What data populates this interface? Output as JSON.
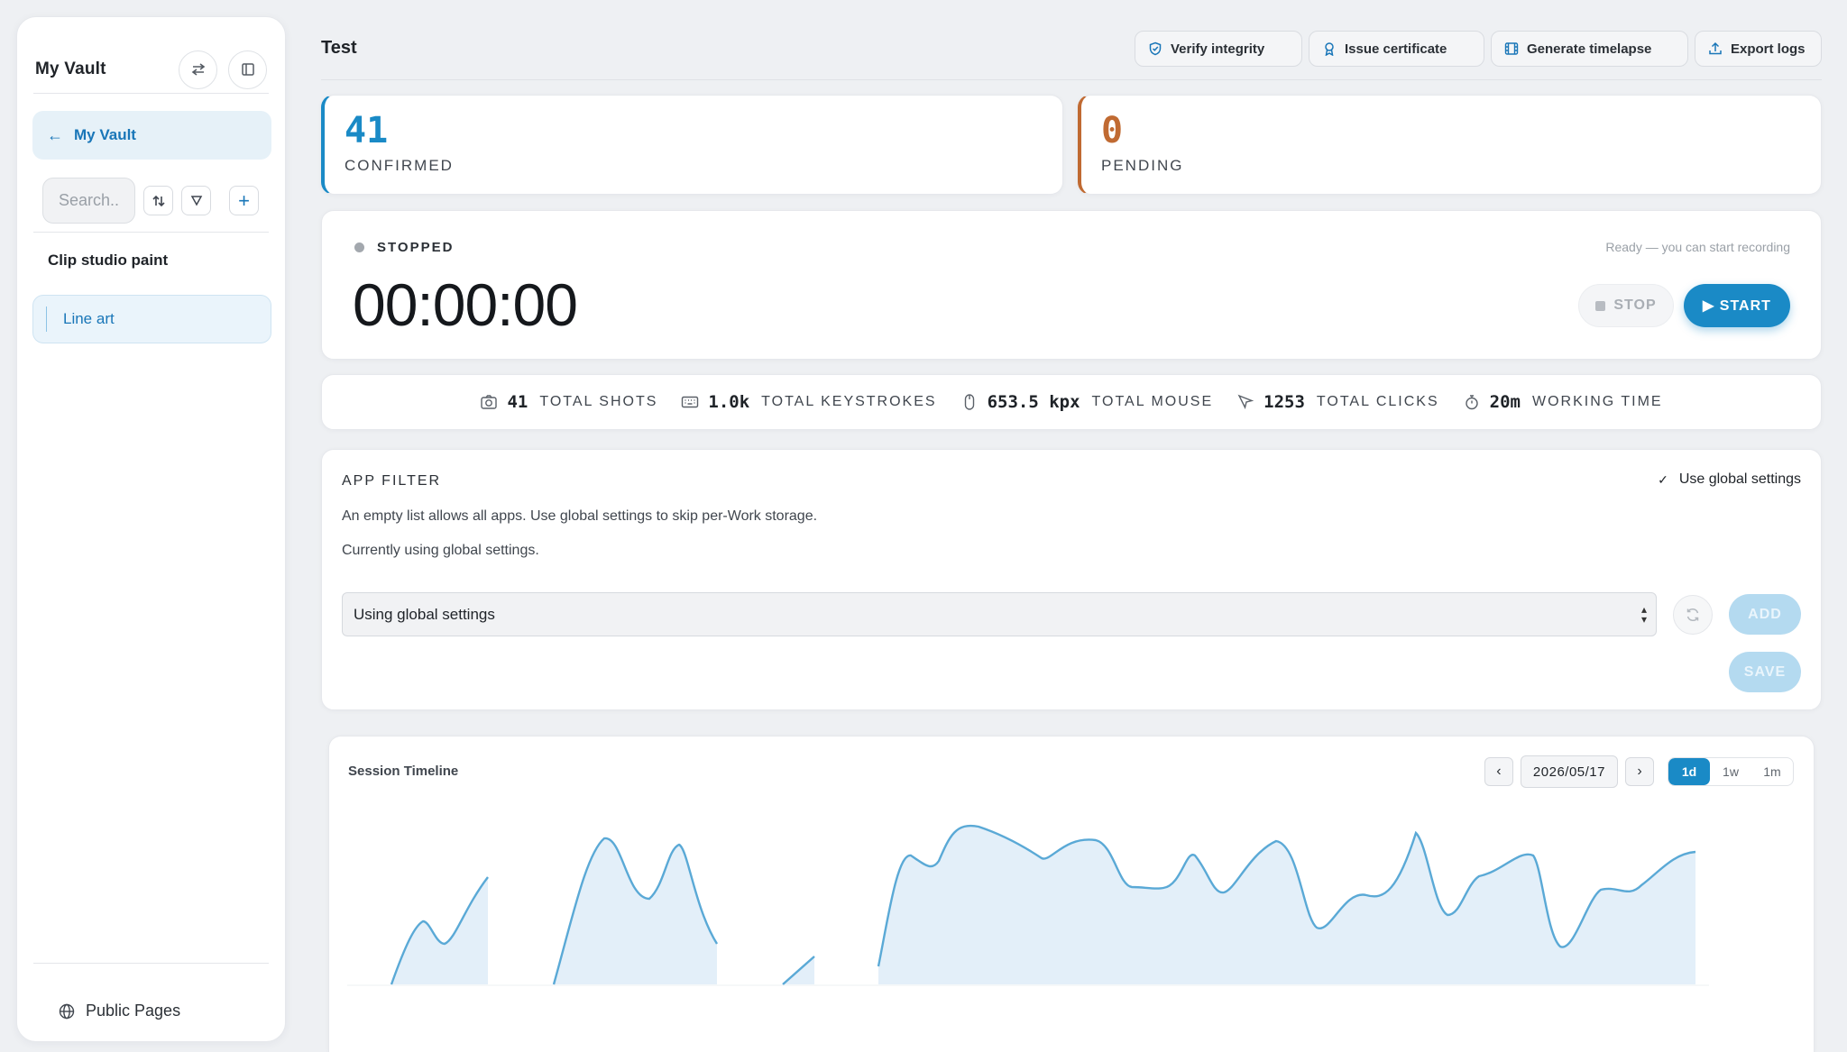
{
  "sidebar": {
    "title": "My Vault",
    "back_label": "My Vault",
    "search_placeholder": "Search..",
    "group_label": "Clip studio paint",
    "items": [
      {
        "label": "Line art"
      }
    ],
    "footer_link": "Public Pages"
  },
  "header": {
    "title": "Test",
    "buttons": [
      {
        "label": "Verify integrity",
        "icon": "shield-icon"
      },
      {
        "label": "Issue certificate",
        "icon": "award-icon"
      },
      {
        "label": "Generate timelapse",
        "icon": "film-icon"
      },
      {
        "label": "Export logs",
        "icon": "upload-icon"
      }
    ]
  },
  "stats": {
    "confirmed": {
      "value": "41",
      "label": "CONFIRMED",
      "color": "#1a8ac6"
    },
    "pending": {
      "value": "0",
      "label": "PENDING",
      "color": "#c06a32"
    }
  },
  "recorder": {
    "status": "STOPPED",
    "timer": "00:00:00",
    "hint": "Ready — you can start recording",
    "stop_label": "STOP",
    "start_label": "▶ START",
    "accent": "#1a8ac6"
  },
  "metrics": [
    {
      "icon": "camera-icon",
      "value": "41",
      "label": "TOTAL SHOTS"
    },
    {
      "icon": "keyboard-icon",
      "value": "1.0k",
      "label": "TOTAL KEYSTROKES"
    },
    {
      "icon": "mouse-icon",
      "value": "653.5 kpx",
      "label": "TOTAL MOUSE"
    },
    {
      "icon": "cursor-icon",
      "value": "1253",
      "label": "TOTAL CLICKS"
    },
    {
      "icon": "stopwatch-icon",
      "value": "20m",
      "label": "WORKING TIME"
    }
  ],
  "app_filter": {
    "title": "APP FILTER",
    "use_global_label": "Use global settings",
    "use_global_checked": true,
    "description": "An empty list allows all apps. Use global settings to skip per-Work storage.",
    "status": "Currently using global settings.",
    "select_value": "Using global settings",
    "add_label": "ADD",
    "save_label": "SAVE"
  },
  "timeline": {
    "title": "Session Timeline",
    "date": "2026/05/17",
    "prev": "‹",
    "next": "›",
    "ranges": [
      "1d",
      "1w",
      "1m"
    ],
    "active_range": "1d",
    "fill_color": "#e3eff9",
    "line_color": "#5aa9d6"
  }
}
